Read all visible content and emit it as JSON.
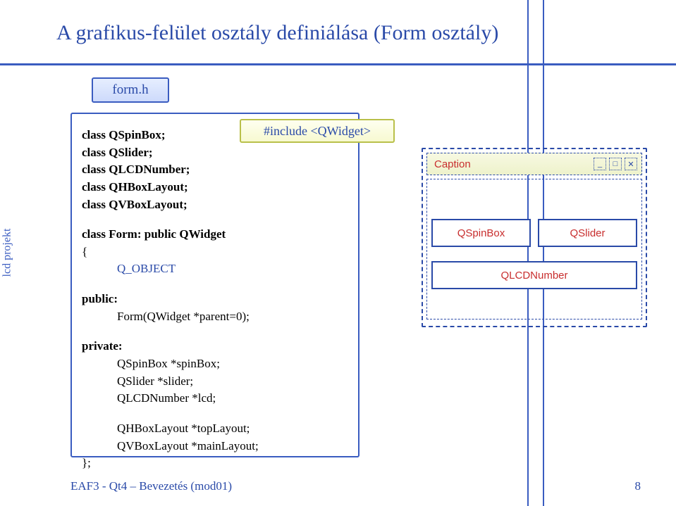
{
  "title": "A grafikus-felület osztály definiálása (Form osztály)",
  "side_label": "lcd projekt",
  "form_h": "form.h",
  "include": "#include <QWidget>",
  "code": {
    "l1": "class QSpinBox;",
    "l2": "class QSlider;",
    "l3": "class QLCDNumber;",
    "l4": "class QHBoxLayout;",
    "l5": "class QVBoxLayout;",
    "l6": "class Form: public QWidget",
    "l7": "{",
    "l8": "Q_OBJECT",
    "l9": "public:",
    "l10": "Form(QWidget *parent=0);",
    "l11": "private:",
    "l12": "QSpinBox *spinBox;",
    "l13": "QSlider *slider;",
    "l14": "QLCDNumber *lcd;",
    "l15": "QHBoxLayout *topLayout;",
    "l16": "QVBoxLayout *mainLayout;",
    "l17": "};"
  },
  "window": {
    "caption": "Caption",
    "spinbox": "QSpinBox",
    "slider": "QSlider",
    "lcd": "QLCDNumber",
    "min": "_",
    "max": "□",
    "close": "✕"
  },
  "footer": {
    "left": "EAF3 - Qt4 – Bevezetés (mod01)",
    "page": "8"
  }
}
